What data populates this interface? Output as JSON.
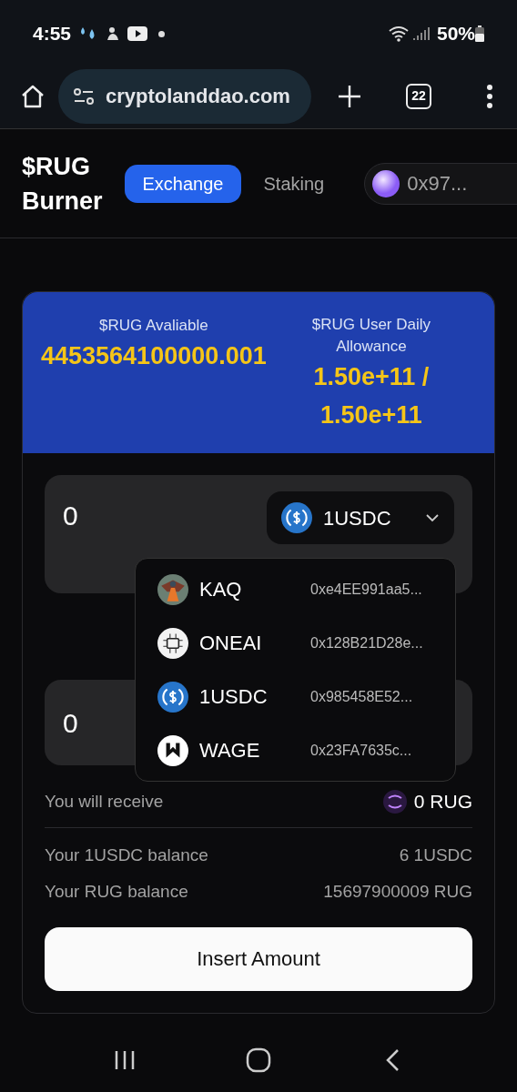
{
  "status_bar": {
    "time": "4:55",
    "battery": "50%"
  },
  "browser": {
    "url": "cryptolanddao.com",
    "tab_count": "22"
  },
  "header": {
    "title_lines": [
      "$RUG",
      "Burner"
    ],
    "tabs": [
      {
        "label": "Exchange",
        "selected": true
      },
      {
        "label": "Staking",
        "selected": false
      }
    ],
    "wallet": "0x97..."
  },
  "stats": [
    {
      "label": "$RUG Avaliable",
      "value": "4453564100000.001"
    },
    {
      "label": "$RUG User Daily Allowance",
      "value": "1.50e+11 / 1.50e+11"
    }
  ],
  "from_amount": "0",
  "token_select": {
    "label": "1USDC",
    "kind": "usdc"
  },
  "to_amount": "0",
  "token_menu": [
    {
      "kind": "kaq",
      "symbol": "KAQ",
      "address": "0xe4EE991aa5..."
    },
    {
      "kind": "oneai",
      "symbol": "ONEAI",
      "address": "0x128B21D28e..."
    },
    {
      "kind": "usdc",
      "symbol": "1USDC",
      "address": "0x985458E52..."
    },
    {
      "kind": "wage",
      "symbol": "WAGE",
      "address": "0x23FA7635c..."
    }
  ],
  "receive": {
    "label": "You will receive",
    "value": "0 RUG"
  },
  "balances": [
    {
      "label": "Your 1USDC balance",
      "value": "6 1USDC"
    },
    {
      "label": "Your RUG balance",
      "value": "15697900009 RUG"
    }
  ],
  "submit": "Insert Amount"
}
